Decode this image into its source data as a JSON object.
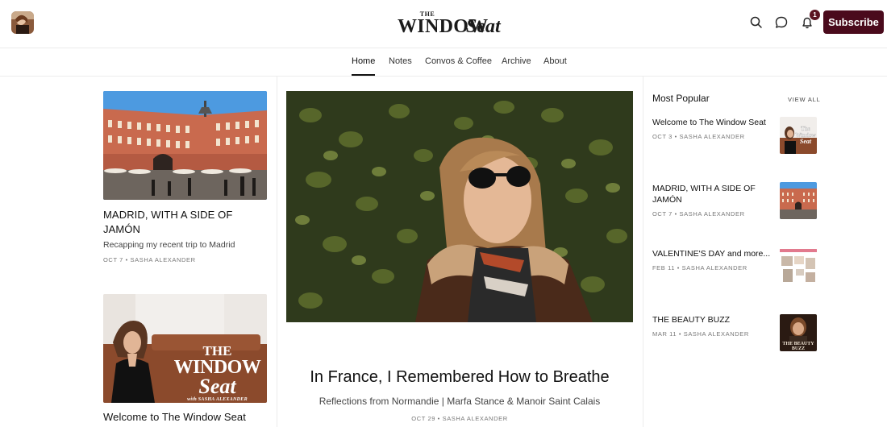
{
  "header": {
    "brand_the": "THE",
    "brand_window": "WINDOW",
    "brand_seat": "Seat",
    "subscribe_label": "Subscribe",
    "notification_count": "1",
    "icons": [
      "search-icon",
      "chat-icon",
      "bell-icon"
    ]
  },
  "nav": {
    "items": [
      {
        "label": "Home",
        "active": true
      },
      {
        "label": "Notes"
      },
      {
        "label": "Convos & Coffee"
      },
      {
        "label": "Archive"
      },
      {
        "label": "About"
      }
    ]
  },
  "left_posts": [
    {
      "title": "MADRID, WITH A SIDE OF JAMÓN",
      "subtitle": "Recapping my recent trip to Madrid",
      "meta": "OCT 7 • SASHA ALEXANDER"
    },
    {
      "title": "Welcome to The Window Seat",
      "cover_line1": "THE",
      "cover_line2": "WINDOW",
      "cover_line3": "Seat",
      "cover_credit": "with SASHA ALEXANDER"
    }
  ],
  "featured": {
    "title": "In France, I Remembered How to Breathe",
    "subtitle": "Reflections from Normandie | Marfa Stance & Manoir Saint Calais",
    "meta": "OCT 29 • SASHA ALEXANDER"
  },
  "popular": {
    "heading": "Most Popular",
    "view_all": "VIEW ALL",
    "items": [
      {
        "title": "Welcome to The Window Seat",
        "meta": "OCT 3 • SASHA ALEXANDER"
      },
      {
        "title": "MADRID, WITH A SIDE OF JAMÓN",
        "meta": "OCT 7 • SASHA ALEXANDER"
      },
      {
        "title": "VALENTINE'S DAY and more...",
        "meta": "FEB 11 • SASHA ALEXANDER"
      },
      {
        "title": "THE BEAUTY BUZZ",
        "meta": "MAR 11 • SASHA ALEXANDER"
      }
    ]
  },
  "colors": {
    "accent": "#4a0a1c",
    "badge": "#5a1422",
    "divider": "#ececec"
  }
}
